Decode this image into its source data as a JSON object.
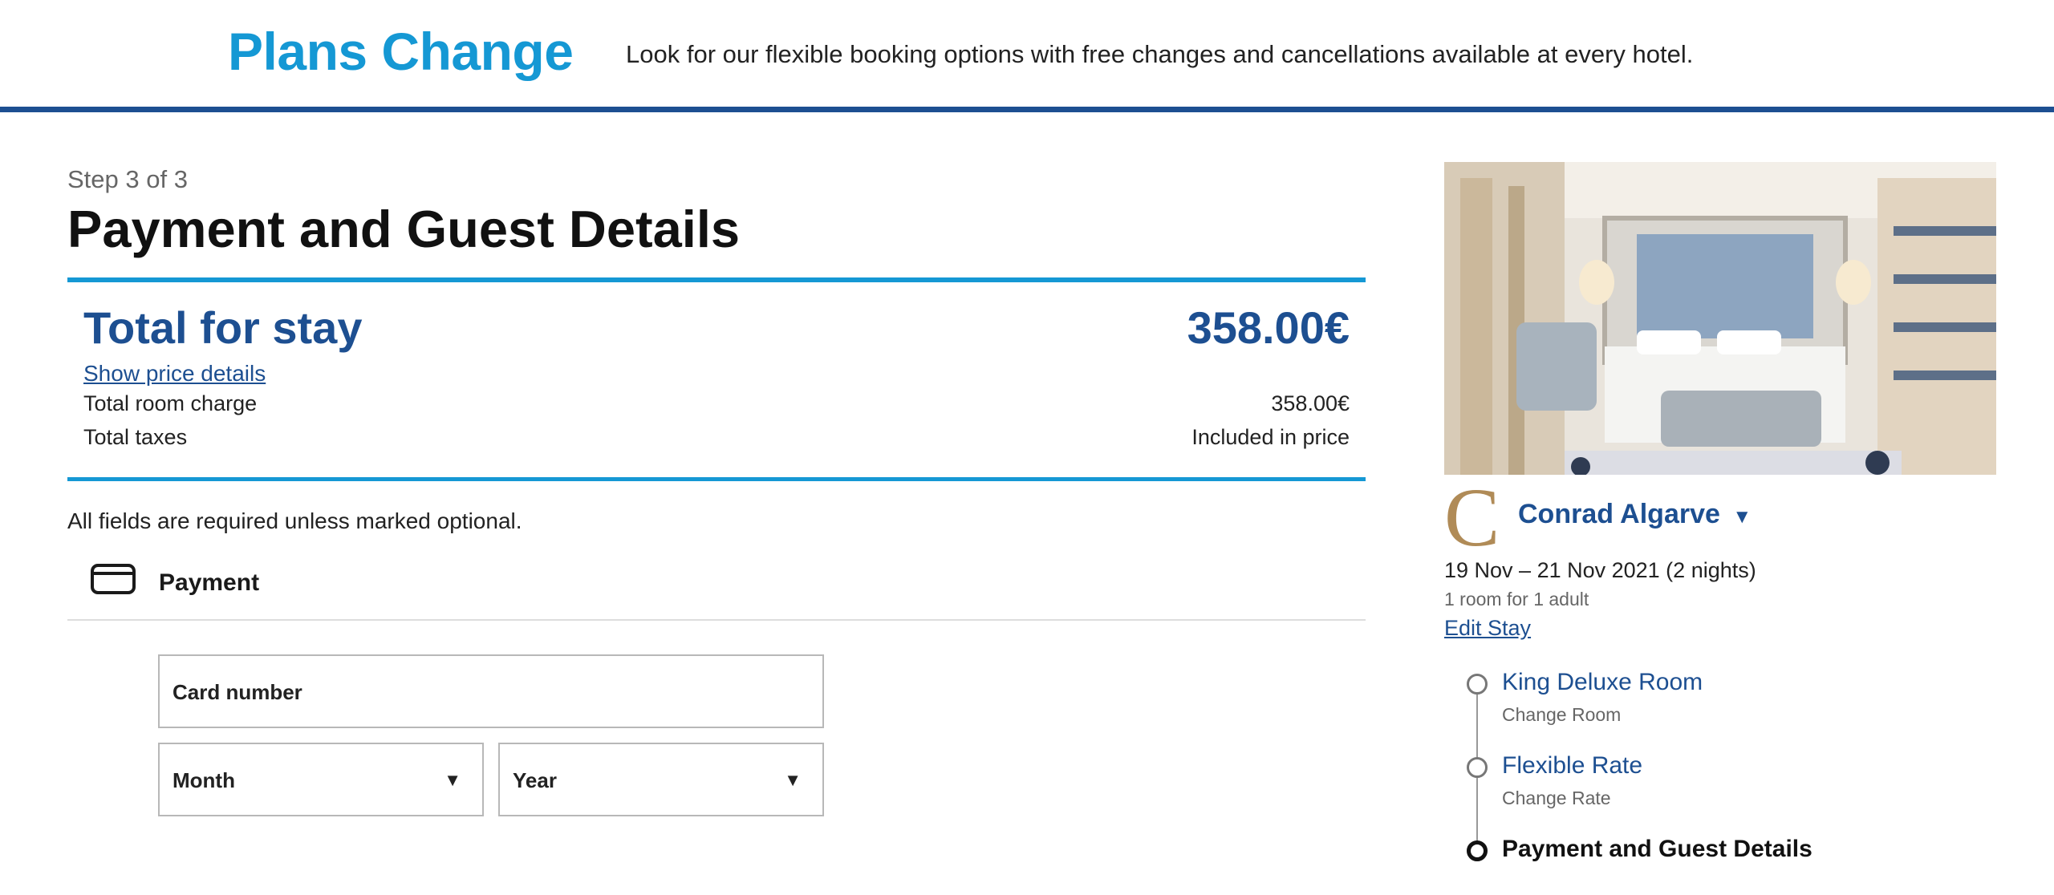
{
  "banner": {
    "title": "Plans Change",
    "text": "Look for our flexible booking options with free changes and cancellations available at every hotel."
  },
  "checkout": {
    "step": "Step 3 of 3",
    "title": "Payment and Guest Details",
    "total_label": "Total for stay",
    "total_amount": "358.00€",
    "show_price_details": "Show price details",
    "rows": [
      {
        "label": "Total room charge",
        "value": "358.00€"
      },
      {
        "label": "Total taxes",
        "value": "Included in price"
      }
    ],
    "required_note": "All fields are required unless marked optional.",
    "payment": {
      "label": "Payment",
      "card_number_label": "Card number",
      "month_label": "Month",
      "year_label": "Year"
    }
  },
  "stay": {
    "logo_letter": "C",
    "hotel_name": "Conrad Algarve",
    "dates": "19 Nov – 21 Nov 2021 (2 nights)",
    "guests": "1 room for 1 adult",
    "edit_label": "Edit Stay",
    "steps": [
      {
        "title": "King Deluxe Room",
        "sub": "Change Room"
      },
      {
        "title": "Flexible Rate",
        "sub": "Change Rate"
      },
      {
        "title": "Payment and Guest Details",
        "sub": ""
      }
    ]
  },
  "colors": {
    "brand_blue": "#1d4f91",
    "accent_blue": "#1598d4",
    "logo_gold": "#b08b57"
  },
  "icons": {
    "payment": "credit-card-icon",
    "dropdown": "caret-down-icon",
    "hotel_dropdown": "triangle-down-icon"
  }
}
